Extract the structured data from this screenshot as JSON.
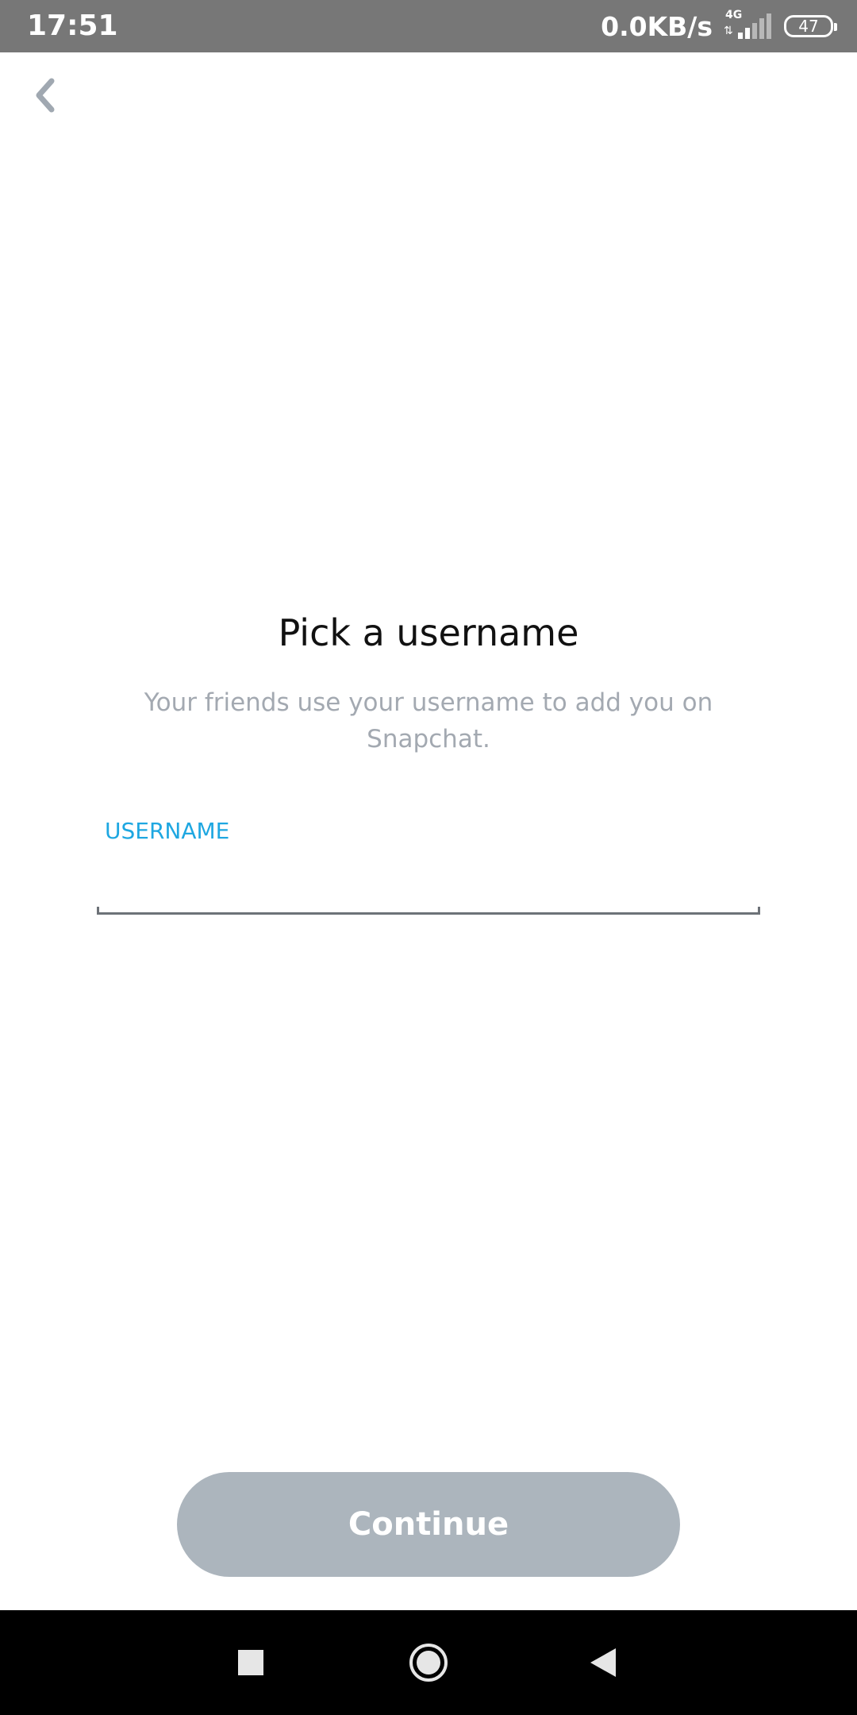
{
  "status_bar": {
    "time": "17:51",
    "net_speed": "0.0KB/s",
    "network_type": "4G",
    "battery_level": "47",
    "signal_icon": "signal-icon",
    "battery_icon": "battery-icon"
  },
  "header": {
    "back_icon": "chevron-left-icon"
  },
  "main": {
    "title": "Pick a username",
    "subtitle": "Your friends use your username to add you on Snapchat.",
    "field_label": "USERNAME",
    "username_value": "",
    "continue_label": "Continue"
  },
  "nav_bar": {
    "buttons": [
      "recents-icon",
      "home-icon",
      "back-icon"
    ]
  },
  "colors": {
    "status_bar": "#777777",
    "accent": "#1ea7e1",
    "subtitle": "#a3a9b1",
    "button_disabled": "#acb5bd",
    "underline": "#6d7278"
  }
}
